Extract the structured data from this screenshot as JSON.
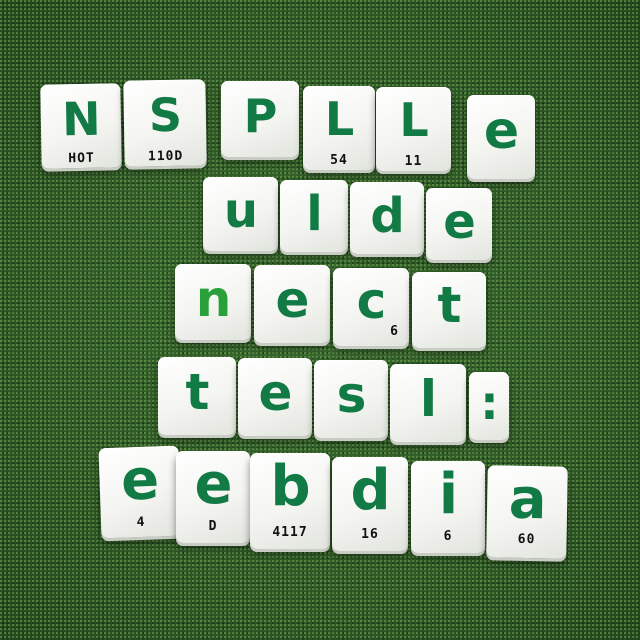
{
  "scene": {
    "background": "#2f5a27",
    "tile_color": "#f4f5f1",
    "letter_color": "#127a45"
  },
  "rows": [
    {
      "tiles": [
        {
          "letter": "N",
          "number": "HOT"
        },
        {
          "letter": "S",
          "number": "110D"
        },
        {
          "letter": "P",
          "number": ""
        },
        {
          "letter": "L",
          "number": "54"
        },
        {
          "letter": "L",
          "number": "11"
        },
        {
          "letter": "e",
          "number": ""
        }
      ]
    },
    {
      "tiles": [
        {
          "letter": "u",
          "number": ""
        },
        {
          "letter": "l",
          "number": ""
        },
        {
          "letter": "d",
          "number": ""
        },
        {
          "letter": "e",
          "number": ""
        }
      ]
    },
    {
      "tiles": [
        {
          "letter": "n",
          "number": ""
        },
        {
          "letter": "e",
          "number": ""
        },
        {
          "letter": "c",
          "number": "6"
        },
        {
          "letter": "t",
          "number": ""
        }
      ]
    },
    {
      "tiles": [
        {
          "letter": "t",
          "number": ""
        },
        {
          "letter": "e",
          "number": ""
        },
        {
          "letter": "s",
          "number": ""
        },
        {
          "letter": "l",
          "number": ""
        },
        {
          "letter": ":",
          "number": ""
        }
      ]
    },
    {
      "tiles": [
        {
          "letter": "e",
          "number": "4"
        },
        {
          "letter": "e",
          "number": "D"
        },
        {
          "letter": "b",
          "number": "4117"
        },
        {
          "letter": "d",
          "number": "16"
        },
        {
          "letter": "i",
          "number": "6"
        },
        {
          "letter": "a",
          "number": "60"
        }
      ]
    }
  ]
}
